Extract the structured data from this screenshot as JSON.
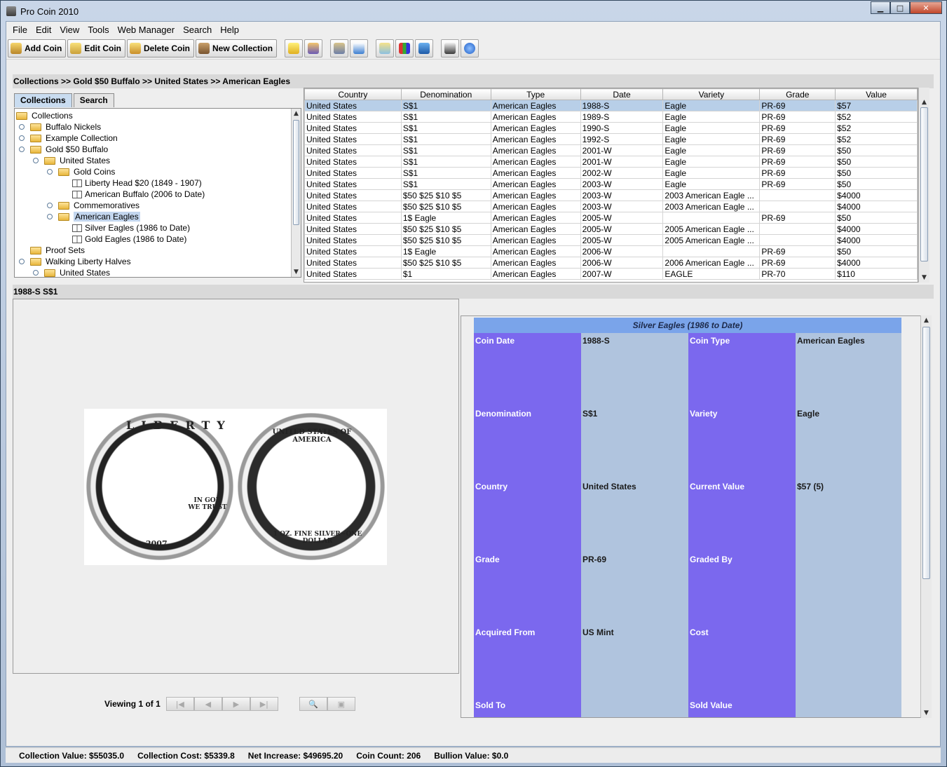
{
  "window": {
    "title": "Pro Coin 2010"
  },
  "menu": [
    "File",
    "Edit",
    "View",
    "Tools",
    "Web Manager",
    "Search",
    "Help"
  ],
  "toolbar": {
    "buttons": [
      {
        "label": "Add Coin",
        "icon": "add-coin-icon"
      },
      {
        "label": "Edit Coin",
        "icon": "edit-coin-icon"
      },
      {
        "label": "Delete Coin",
        "icon": "delete-coin-icon"
      },
      {
        "label": "New Collection",
        "icon": "new-collection-icon"
      }
    ],
    "icon_buttons": [
      "notes-icon",
      "users-icon",
      "import-icon",
      "calendar-icon",
      "map-icon",
      "chart-icon",
      "web-icon",
      "print-icon",
      "help-icon"
    ]
  },
  "breadcrumb": "Collections >> Gold $50 Buffalo >> United States >> American Eagles",
  "tabs": [
    "Collections",
    "Search"
  ],
  "tree": [
    {
      "label": "Collections",
      "type": "folder",
      "level": 0
    },
    {
      "label": "Buffalo Nickels",
      "type": "folder",
      "level": 1
    },
    {
      "label": "Example Collection",
      "type": "folder",
      "level": 1
    },
    {
      "label": "Gold $50 Buffalo",
      "type": "folder",
      "level": 1
    },
    {
      "label": "United States",
      "type": "folder",
      "level": 2
    },
    {
      "label": "Gold Coins",
      "type": "folder",
      "level": 3
    },
    {
      "label": "Liberty Head $20 (1849 - 1907)",
      "type": "book",
      "level": 4
    },
    {
      "label": "American Buffalo (2006 to Date)",
      "type": "book",
      "level": 4
    },
    {
      "label": "Commemoratives",
      "type": "folder",
      "level": 3
    },
    {
      "label": "American Eagles",
      "type": "folder",
      "level": 3,
      "selected": true
    },
    {
      "label": "Silver Eagles (1986 to Date)",
      "type": "book",
      "level": 4
    },
    {
      "label": "Gold Eagles (1986 to Date)",
      "type": "book",
      "level": 4
    },
    {
      "label": "Proof Sets",
      "type": "folder",
      "level": 1
    },
    {
      "label": "Walking Liberty Halves",
      "type": "folder",
      "level": 1
    },
    {
      "label": "United States",
      "type": "folder",
      "level": 2
    }
  ],
  "grid": {
    "columns": [
      "Country",
      "Denomination",
      "Type",
      "Date",
      "Variety",
      "Grade",
      "Value"
    ],
    "rows": [
      [
        "United States",
        "S$1",
        "American Eagles",
        "1988-S",
        "Eagle",
        "PR-69",
        "$57"
      ],
      [
        "United States",
        "S$1",
        "American Eagles",
        "1989-S",
        "Eagle",
        "PR-69",
        "$52"
      ],
      [
        "United States",
        "S$1",
        "American Eagles",
        "1990-S",
        "Eagle",
        "PR-69",
        "$52"
      ],
      [
        "United States",
        "S$1",
        "American Eagles",
        "1992-S",
        "Eagle",
        "PR-69",
        "$52"
      ],
      [
        "United States",
        "S$1",
        "American Eagles",
        "2001-W",
        "Eagle",
        "PR-69",
        "$50"
      ],
      [
        "United States",
        "S$1",
        "American Eagles",
        "2001-W",
        "Eagle",
        "PR-69",
        "$50"
      ],
      [
        "United States",
        "S$1",
        "American Eagles",
        "2002-W",
        "Eagle",
        "PR-69",
        "$50"
      ],
      [
        "United States",
        "S$1",
        "American Eagles",
        "2003-W",
        "Eagle",
        "PR-69",
        "$50"
      ],
      [
        "United States",
        "$50 $25 $10 $5",
        "American Eagles",
        "2003-W",
        "2003 American Eagle ...",
        "",
        "$4000"
      ],
      [
        "United States",
        "$50 $25 $10 $5",
        "American Eagles",
        "2003-W",
        "2003 American Eagle ...",
        "",
        "$4000"
      ],
      [
        "United States",
        "1$ Eagle",
        "American Eagles",
        "2005-W",
        "",
        "PR-69",
        "$50"
      ],
      [
        "United States",
        "$50 $25 $10 $5",
        "American Eagles",
        "2005-W",
        "2005 American Eagle ...",
        "",
        "$4000"
      ],
      [
        "United States",
        "$50 $25 $10 $5",
        "American Eagles",
        "2005-W",
        "2005 American Eagle ...",
        "",
        "$4000"
      ],
      [
        "United States",
        "1$ Eagle",
        "American Eagles",
        "2006-W",
        "",
        "PR-69",
        "$50"
      ],
      [
        "United States",
        "$50 $25 $10 $5",
        "American Eagles",
        "2006-W",
        "2006 American Eagle ...",
        "PR-69",
        "$4000"
      ],
      [
        "United States",
        "$1",
        "American Eagles",
        "2007-W",
        "EAGLE",
        "PR-70",
        "$110"
      ]
    ],
    "selected_row": 0
  },
  "coin_heading": "1988-S S$1",
  "coin_image": {
    "obverse_date": "2007",
    "obverse_motto": "IN GOD WE TRUST",
    "obverse_legend": "LIBERTY",
    "reverse_top": "UNITED STATES OF AMERICA",
    "reverse_bottom": "1 OZ. FINE SILVER~ONE DOLLAR"
  },
  "viewer_nav": {
    "label": "Viewing 1 of 1"
  },
  "detail": {
    "title": "Silver Eagles (1986 to Date)",
    "left": [
      {
        "label": "Coin Date",
        "value": "1988-S"
      },
      {
        "label": "Denomination",
        "value": "S$1"
      },
      {
        "label": "Country",
        "value": "United States"
      },
      {
        "label": "Grade",
        "value": "PR-69"
      },
      {
        "label": "Acquired From",
        "value": "US Mint"
      },
      {
        "label": "Sold To",
        "value": ""
      }
    ],
    "right": [
      {
        "label": "Coin Type",
        "value": "American Eagles"
      },
      {
        "label": "Variety",
        "value": "Eagle"
      },
      {
        "label": "Current Value",
        "value": "$57 (5)"
      },
      {
        "label": "Graded By",
        "value": ""
      },
      {
        "label": "Cost",
        "value": ""
      },
      {
        "label": "Sold Value",
        "value": ""
      }
    ],
    "label_color": "#7b68ee",
    "value_color": "#b0c4de",
    "title_color": "#7aa4ea"
  },
  "status": {
    "collection_value": "Collection Value: $55035.0",
    "collection_cost": "Collection Cost: $5339.8",
    "net_increase": "Net Increase: $49695.20",
    "coin_count": "Coin Count: 206",
    "bullion_value": "Bullion Value: $0.0"
  }
}
